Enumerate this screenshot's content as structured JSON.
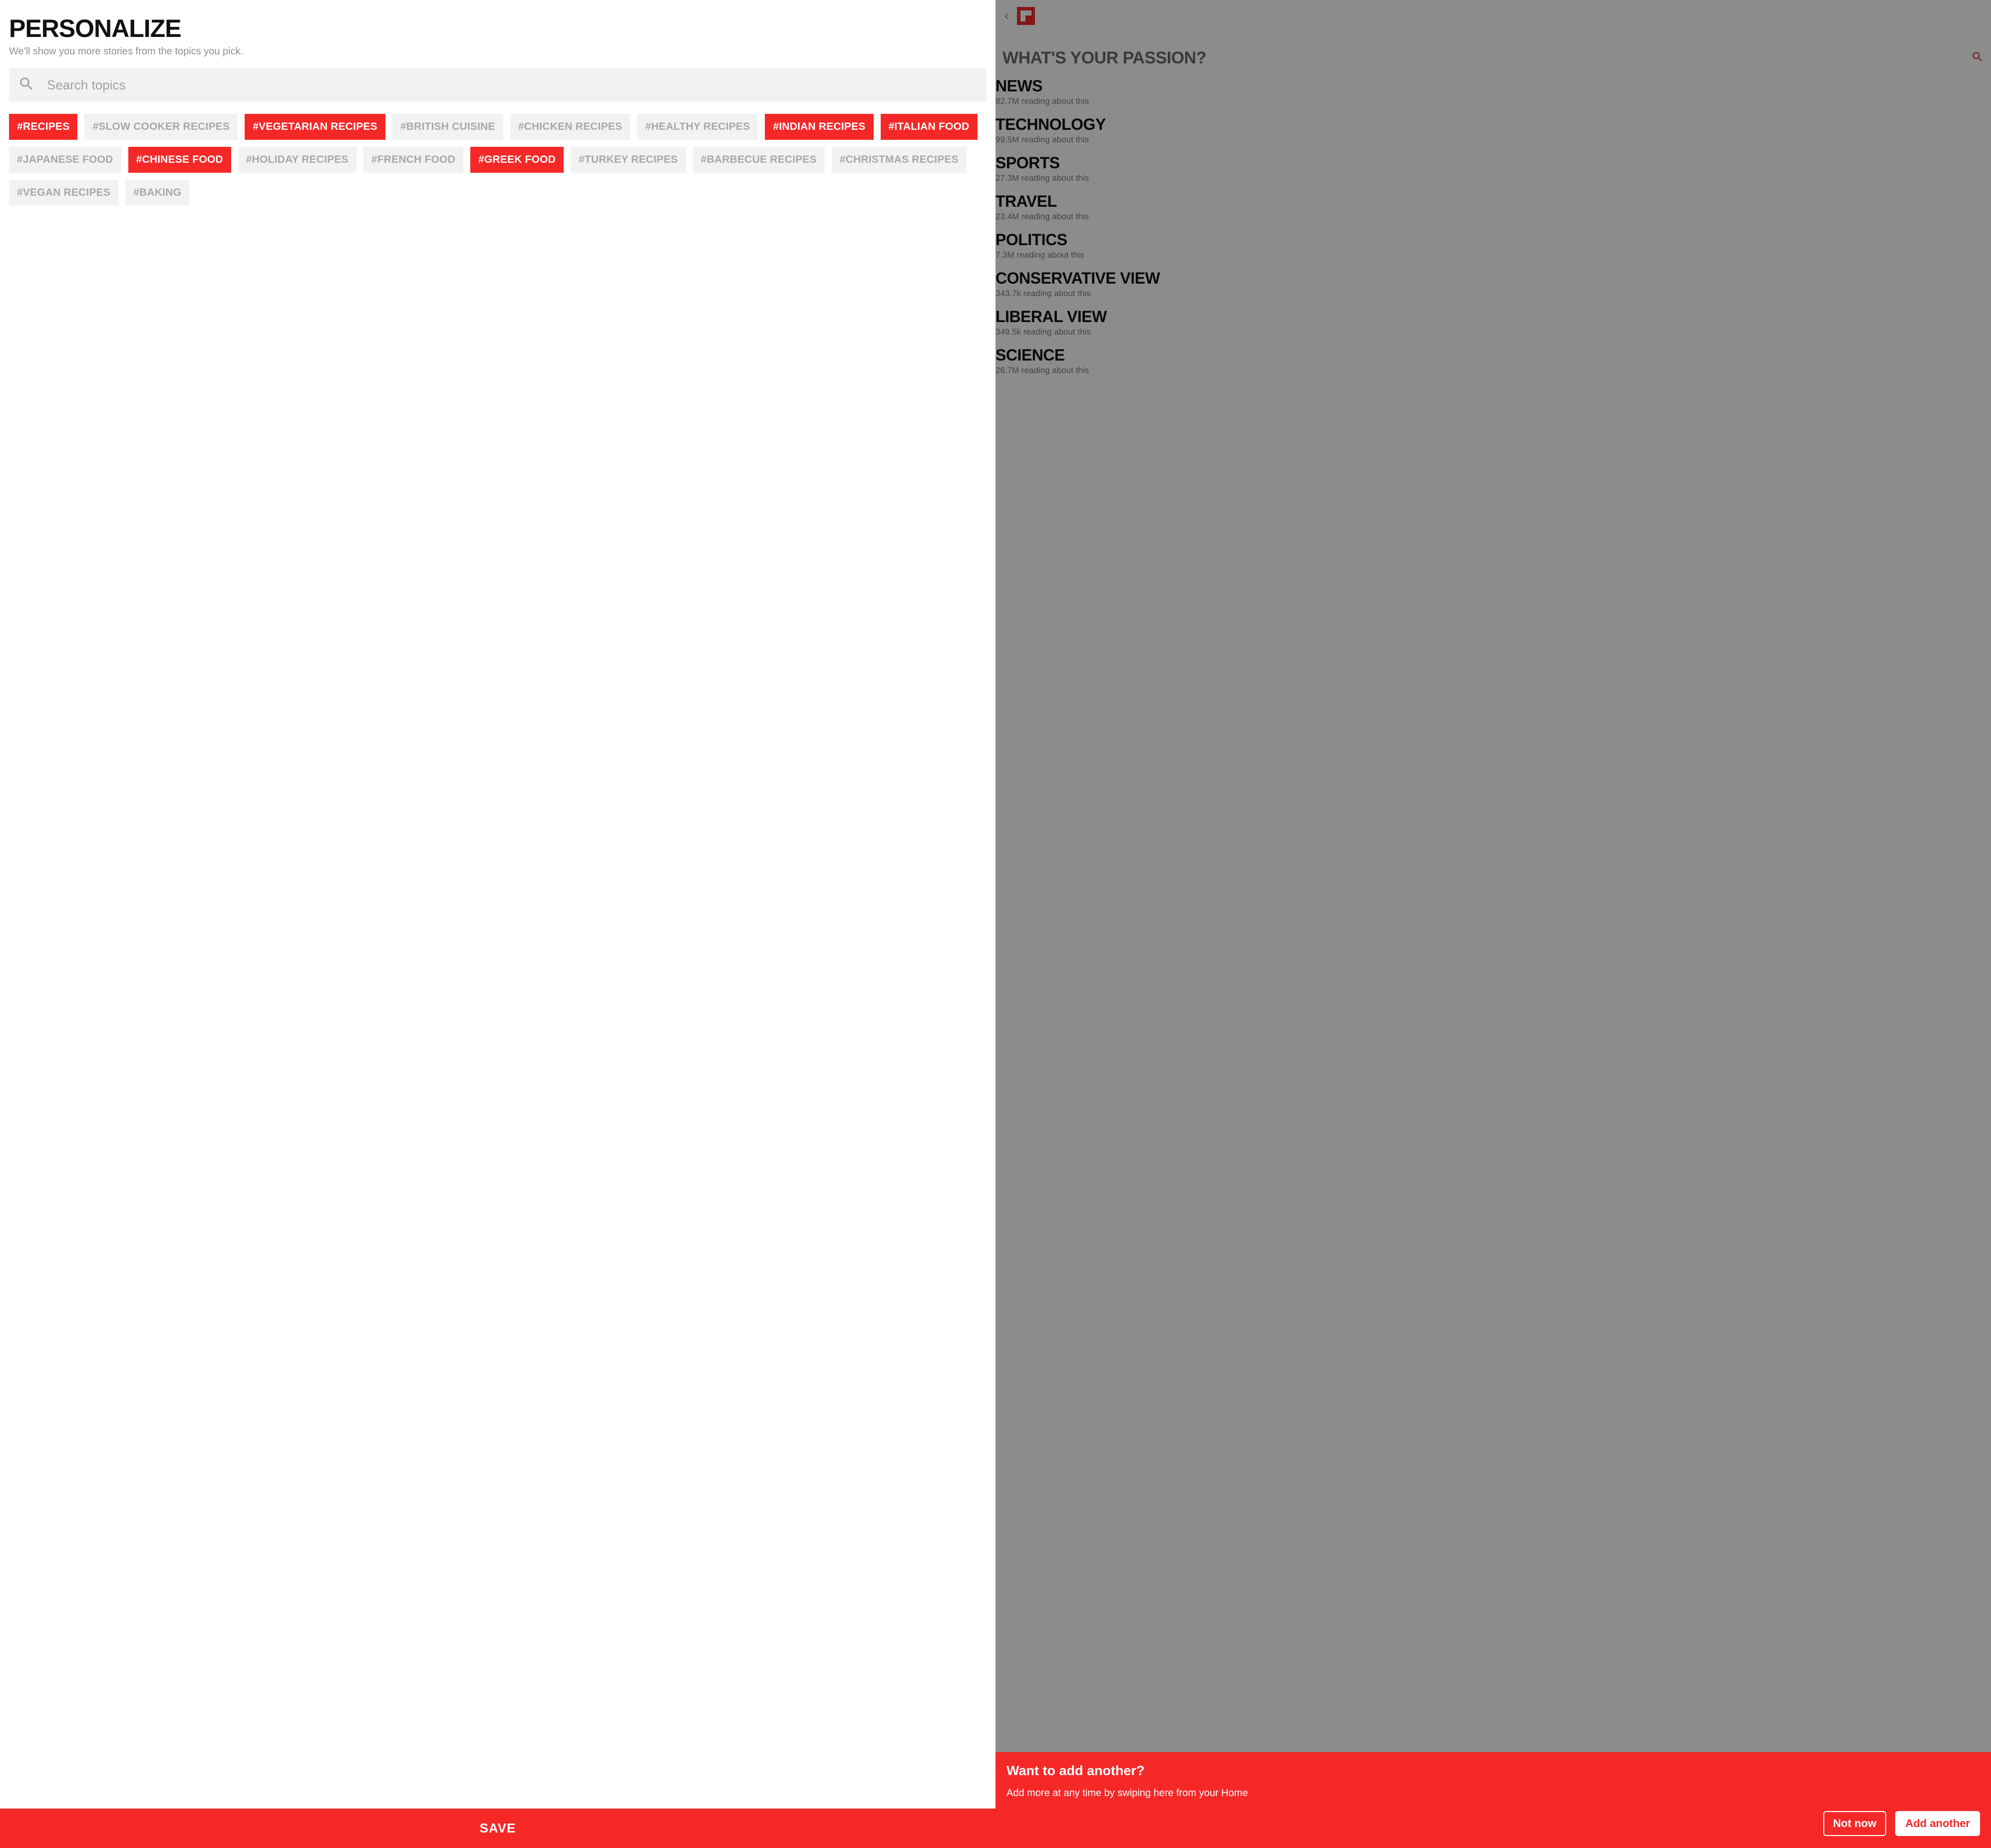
{
  "left": {
    "title": "PERSONALIZE",
    "subtitle": "We'll show you more stories from the topics you pick.",
    "search_placeholder": "Search topics",
    "chips": [
      {
        "label": "#RECIPES",
        "selected": true
      },
      {
        "label": "#SLOW COOKER RECIPES",
        "selected": false
      },
      {
        "label": "#VEGETARIAN RECIPES",
        "selected": true
      },
      {
        "label": "#BRITISH CUISINE",
        "selected": false
      },
      {
        "label": "#CHICKEN RECIPES",
        "selected": false
      },
      {
        "label": "#HEALTHY RECIPES",
        "selected": false
      },
      {
        "label": "#INDIAN RECIPES",
        "selected": true
      },
      {
        "label": "#ITALIAN FOOD",
        "selected": true
      },
      {
        "label": "#JAPANESE FOOD",
        "selected": false
      },
      {
        "label": "#CHINESE FOOD",
        "selected": true
      },
      {
        "label": "#HOLIDAY RECIPES",
        "selected": false
      },
      {
        "label": "#FRENCH FOOD",
        "selected": false
      },
      {
        "label": "#GREEK FOOD",
        "selected": true
      },
      {
        "label": "#TURKEY RECIPES",
        "selected": false
      },
      {
        "label": "#BARBECUE RECIPES",
        "selected": false
      },
      {
        "label": "#CHRISTMAS RECIPES",
        "selected": false
      },
      {
        "label": "#VEGAN RECIPES",
        "selected": false
      },
      {
        "label": "#BAKING",
        "selected": false
      }
    ],
    "save_label": "SAVE"
  },
  "right": {
    "header": "WHAT'S YOUR PASSION?",
    "passions": [
      {
        "name": "NEWS",
        "sub": "82.7M reading about this"
      },
      {
        "name": "TECHNOLOGY",
        "sub": "99.5M reading about this"
      },
      {
        "name": "SPORTS",
        "sub": "27.3M reading about this"
      },
      {
        "name": "TRAVEL",
        "sub": "23.4M reading about this"
      },
      {
        "name": "POLITICS",
        "sub": "7.3M reading about this"
      },
      {
        "name": "CONSERVATIVE VIEW",
        "sub": "343.7k reading about this"
      },
      {
        "name": "LIBERAL VIEW",
        "sub": "349.5k reading about this"
      },
      {
        "name": "SCIENCE",
        "sub": "26.7M reading about this"
      }
    ],
    "sheet": {
      "title": "Want to add another?",
      "body": "Add more at any time by swiping here from your Home",
      "not_now": "Not now",
      "add_another": "Add another"
    }
  }
}
